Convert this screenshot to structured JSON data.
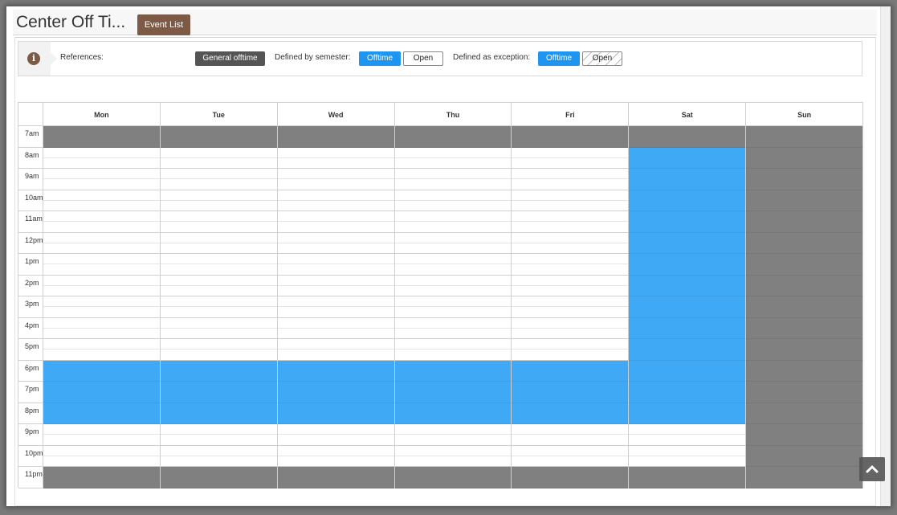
{
  "header": {
    "title": "Center Off Ti...",
    "event_list_label": "Event List"
  },
  "references": {
    "label": "References:",
    "general_offtime": "General offtime",
    "semester_label": "Defined by semester:",
    "semester_offtime": "Offtime",
    "semester_open": "Open",
    "exception_label": "Defined as exception:",
    "exception_offtime": "Offtime",
    "exception_open": "Open"
  },
  "calendar": {
    "days": [
      "Mon",
      "Tue",
      "Wed",
      "Thu",
      "Fri",
      "Sat",
      "Sun"
    ],
    "hours": [
      "7am",
      "8am",
      "9am",
      "10am",
      "11am",
      "12pm",
      "1pm",
      "2pm",
      "3pm",
      "4pm",
      "5pm",
      "6pm",
      "7pm",
      "8pm",
      "9pm",
      "10pm",
      "11pm"
    ],
    "legend_colors": {
      "general_offtime": "#808080",
      "semester_offtime": "#3fa9f5",
      "open": "#ffffff"
    },
    "schedule": {
      "Mon": [
        "general",
        "open",
        "open",
        "open",
        "open",
        "open",
        "open",
        "open",
        "open",
        "open",
        "open",
        "semester",
        "semester",
        "semester",
        "open",
        "open",
        "general"
      ],
      "Tue": [
        "general",
        "open",
        "open",
        "open",
        "open",
        "open",
        "open",
        "open",
        "open",
        "open",
        "open",
        "semester",
        "semester",
        "semester",
        "open",
        "open",
        "general"
      ],
      "Wed": [
        "general",
        "open",
        "open",
        "open",
        "open",
        "open",
        "open",
        "open",
        "open",
        "open",
        "open",
        "semester",
        "semester",
        "semester",
        "open",
        "open",
        "general"
      ],
      "Thu": [
        "general",
        "open",
        "open",
        "open",
        "open",
        "open",
        "open",
        "open",
        "open",
        "open",
        "open",
        "semester",
        "semester",
        "semester",
        "open",
        "open",
        "general"
      ],
      "Fri": [
        "general",
        "open",
        "open",
        "open",
        "open",
        "open",
        "open",
        "open",
        "open",
        "open",
        "open",
        "semester",
        "semester",
        "semester",
        "open",
        "open",
        "general"
      ],
      "Sat": [
        "general",
        "semester",
        "semester",
        "semester",
        "semester",
        "semester",
        "semester",
        "semester",
        "semester",
        "semester",
        "semester",
        "semester",
        "semester",
        "semester",
        "open",
        "open",
        "general"
      ],
      "Sun": [
        "general",
        "general",
        "general",
        "general",
        "general",
        "general",
        "general",
        "general",
        "general",
        "general",
        "general",
        "general",
        "general",
        "general",
        "general",
        "general",
        "general"
      ]
    }
  },
  "scroll_top_icon": "chevron-up-icon"
}
